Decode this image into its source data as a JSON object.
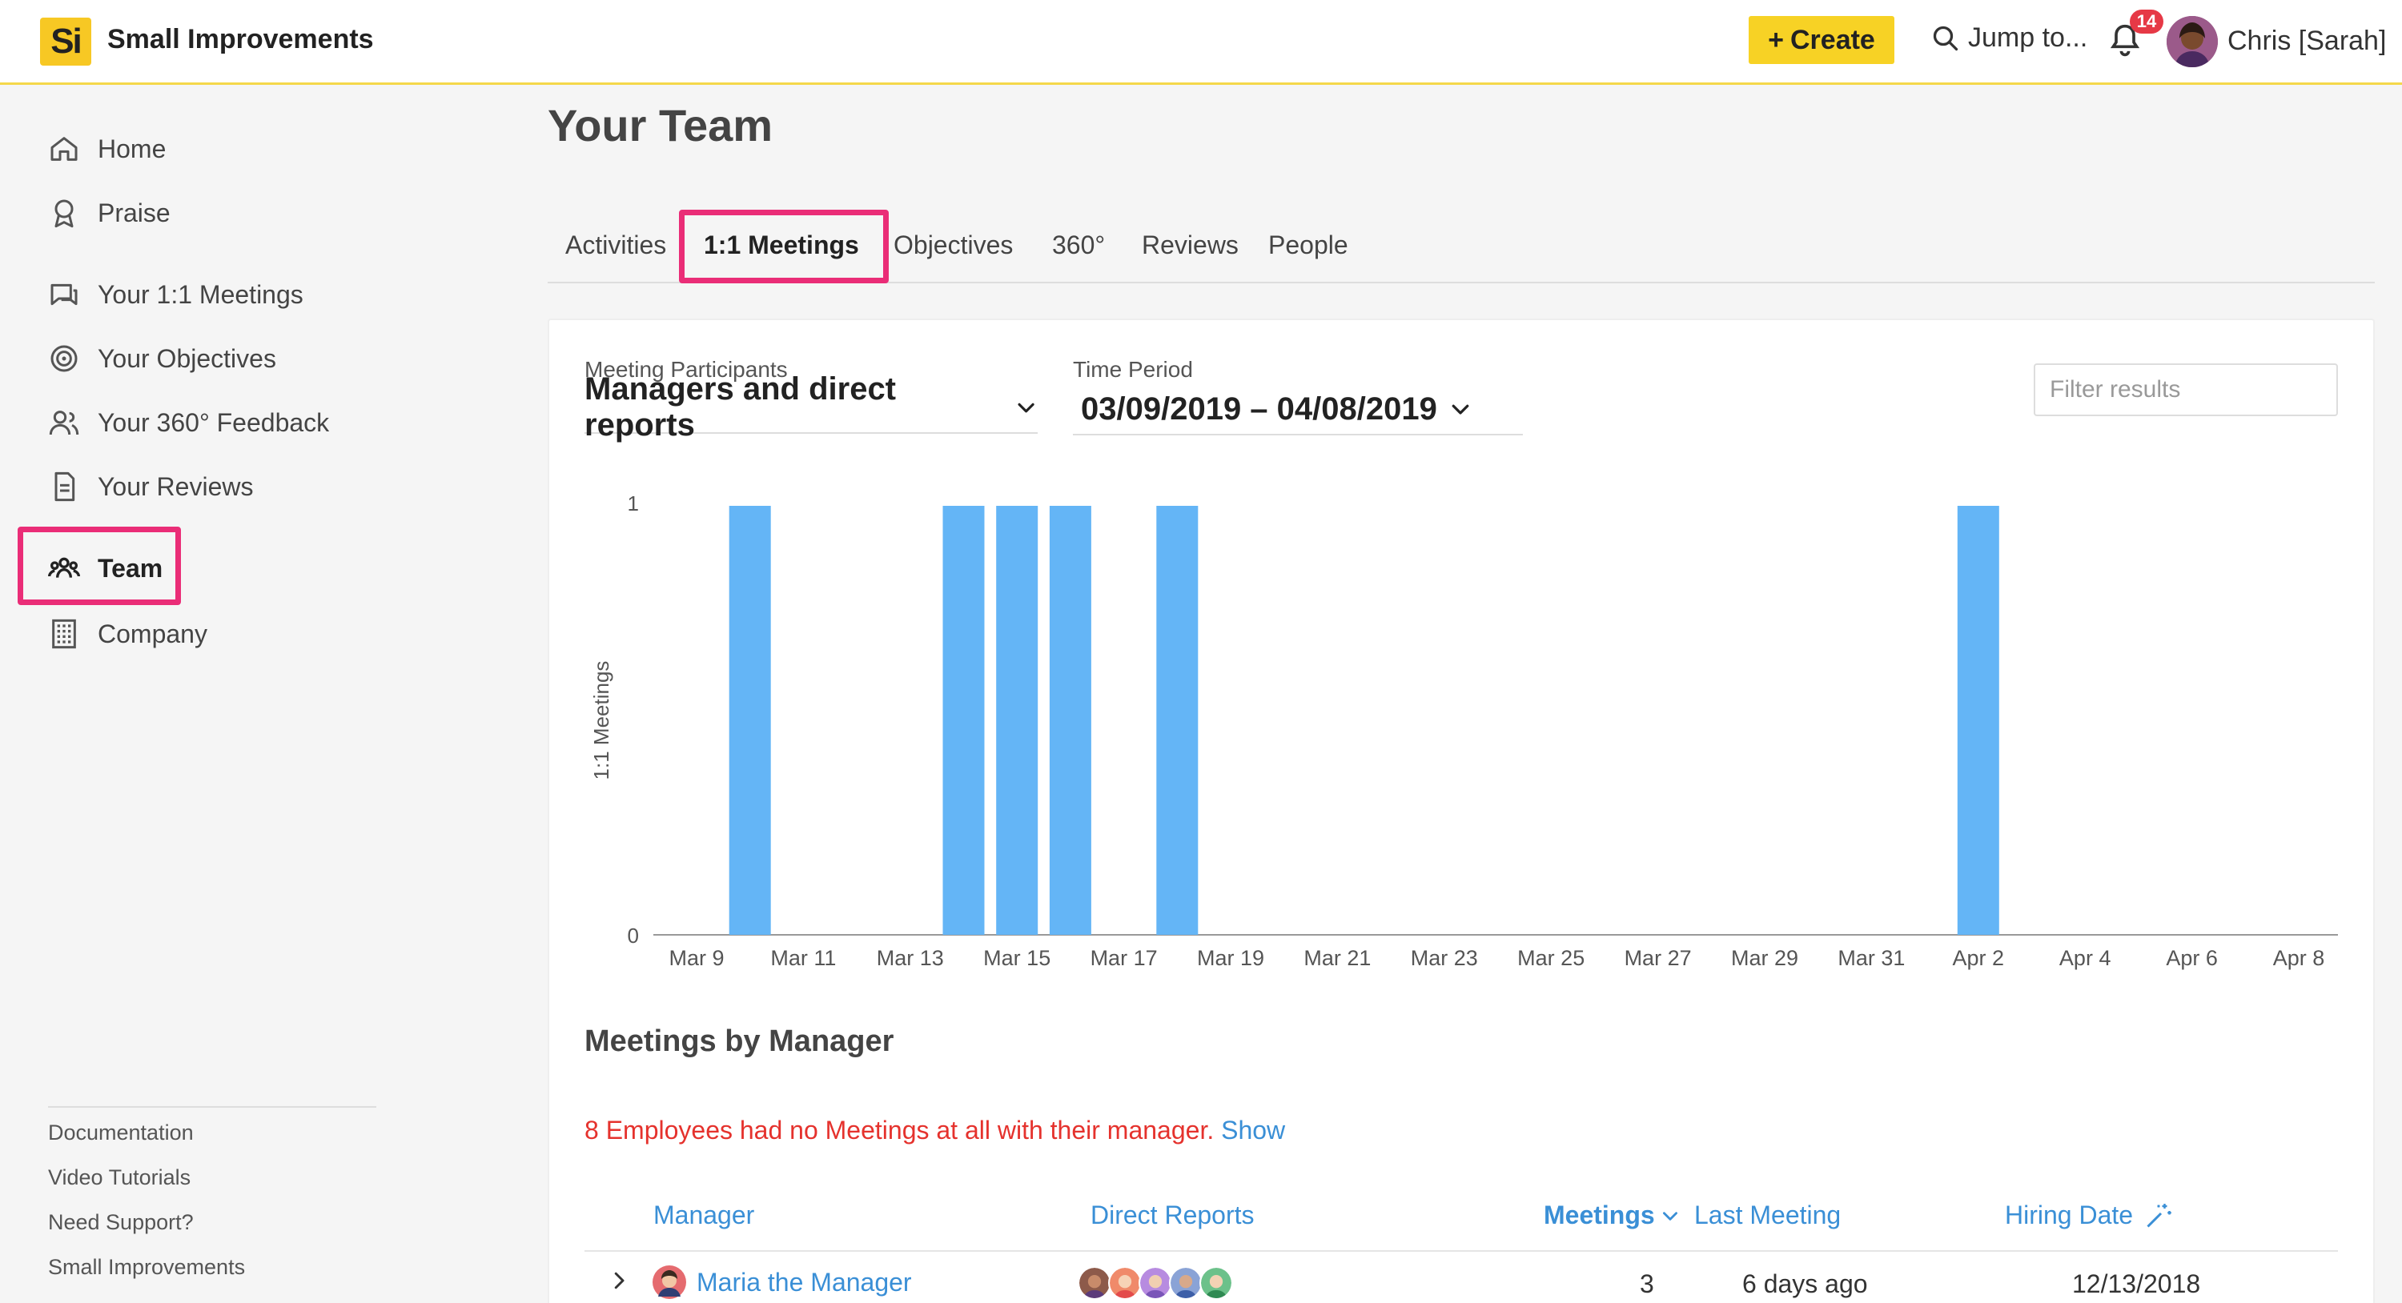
{
  "app": {
    "logo_text": "Si",
    "name": "Small Improvements"
  },
  "topbar": {
    "create_label": "Create",
    "jump_label": "Jump to...",
    "notification_count": "14",
    "user_name": "Chris [Sarah]"
  },
  "sidebar": {
    "items": [
      {
        "label": "Home",
        "icon": "home-icon"
      },
      {
        "label": "Praise",
        "icon": "award-icon"
      },
      {
        "label": "Your 1:1 Meetings",
        "icon": "chat-icon"
      },
      {
        "label": "Your Objectives",
        "icon": "target-icon"
      },
      {
        "label": "Your 360° Feedback",
        "icon": "people-icon"
      },
      {
        "label": "Your Reviews",
        "icon": "document-icon"
      },
      {
        "label": "Team",
        "icon": "team-icon",
        "active": true
      },
      {
        "label": "Company",
        "icon": "building-icon"
      }
    ],
    "footer_links": [
      "Documentation",
      "Video Tutorials",
      "Need Support?",
      "Small Improvements"
    ]
  },
  "page": {
    "title": "Your Team",
    "tabs": [
      "Activities",
      "1:1 Meetings",
      "Objectives",
      "360°",
      "Reviews",
      "People"
    ],
    "active_tab": "1:1 Meetings"
  },
  "filters": {
    "participants_label": "Meeting Participants",
    "participants_value": "Managers and direct reports",
    "period_label": "Time Period",
    "period_value": "03/09/2019 – 04/08/2019",
    "filter_placeholder": "Filter results"
  },
  "chart_data": {
    "type": "bar",
    "ylabel": "1:1 Meetings",
    "ylim": [
      0,
      1
    ],
    "yticks": [
      "0",
      "1"
    ],
    "x_tick_labels": [
      "Mar 9",
      "Mar 11",
      "Mar 13",
      "Mar 15",
      "Mar 17",
      "Mar 19",
      "Mar 21",
      "Mar 23",
      "Mar 25",
      "Mar 27",
      "Mar 29",
      "Mar 31",
      "Apr 2",
      "Apr 4",
      "Apr 6",
      "Apr 8"
    ],
    "categories": [
      "Mar 9",
      "Mar 10",
      "Mar 11",
      "Mar 12",
      "Mar 13",
      "Mar 14",
      "Mar 15",
      "Mar 16",
      "Mar 17",
      "Mar 18",
      "Mar 19",
      "Mar 20",
      "Mar 21",
      "Mar 22",
      "Mar 23",
      "Mar 24",
      "Mar 25",
      "Mar 26",
      "Mar 27",
      "Mar 28",
      "Mar 29",
      "Mar 30",
      "Mar 31",
      "Apr 1",
      "Apr 2",
      "Apr 3",
      "Apr 4",
      "Apr 5",
      "Apr 6",
      "Apr 7",
      "Apr 8"
    ],
    "values": [
      0,
      1,
      0,
      0,
      0,
      1,
      1,
      1,
      0,
      1,
      0,
      0,
      0,
      0,
      0,
      0,
      0,
      0,
      0,
      0,
      0,
      0,
      0,
      0,
      1,
      0,
      0,
      0,
      0,
      0,
      0
    ],
    "bar_color": "#64b5f6"
  },
  "meetings_by_manager": {
    "title": "Meetings by Manager",
    "notice": "8 Employees had no Meetings at all with their manager.",
    "show_label": "Show",
    "columns": {
      "manager": "Manager",
      "direct_reports": "Direct Reports",
      "meetings": "Meetings",
      "last_meeting": "Last Meeting",
      "hiring_date": "Hiring Date"
    },
    "rows": [
      {
        "manager": "Maria the Manager",
        "meetings": "3",
        "last_meeting": "6 days ago",
        "hiring_date": "12/13/2018"
      }
    ]
  },
  "colors": {
    "accent_yellow": "#f7d225",
    "highlight_pink": "#ea2d77",
    "link_blue": "#3a8fd6",
    "warning_red": "#e5322d"
  }
}
